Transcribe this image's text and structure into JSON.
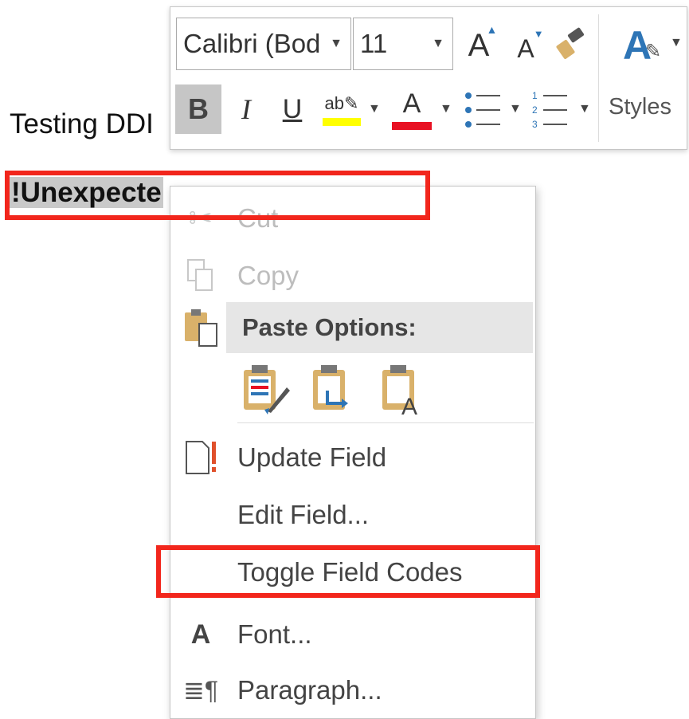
{
  "document": {
    "line1": "Testing DDI",
    "field_text": "!Unexpecte"
  },
  "mini_toolbar": {
    "font_name": "Calibri (Bod",
    "font_size": "11",
    "bold_label": "B",
    "italic_label": "I",
    "underline_label": "U",
    "font_color_label": "A",
    "styles_label": "Styles",
    "highlight_color": "#ffff00",
    "font_color": "#e81123"
  },
  "context_menu": {
    "items": [
      {
        "label": "Cut",
        "icon": "scissors-icon",
        "enabled": false
      },
      {
        "label": "Copy",
        "icon": "copy-icon",
        "enabled": false
      },
      {
        "label": "Update Field",
        "icon": "update-field-icon",
        "enabled": true
      },
      {
        "label": "Edit Field...",
        "icon": "",
        "enabled": true
      },
      {
        "label": "Toggle Field Codes",
        "icon": "",
        "enabled": true
      },
      {
        "label": "Font...",
        "icon": "font-icon",
        "enabled": true
      },
      {
        "label": "Paragraph...",
        "icon": "paragraph-icon",
        "enabled": true
      }
    ],
    "paste_options_label": "Paste Options:",
    "paste_options": [
      {
        "icon": "keep-source-formatting-icon"
      },
      {
        "icon": "merge-formatting-icon"
      },
      {
        "icon": "keep-text-only-icon"
      }
    ]
  },
  "colors": {
    "highlight_border": "#f2261c",
    "menu_hover": "#e6e6e6",
    "field_shading": "#c9c9c9"
  }
}
